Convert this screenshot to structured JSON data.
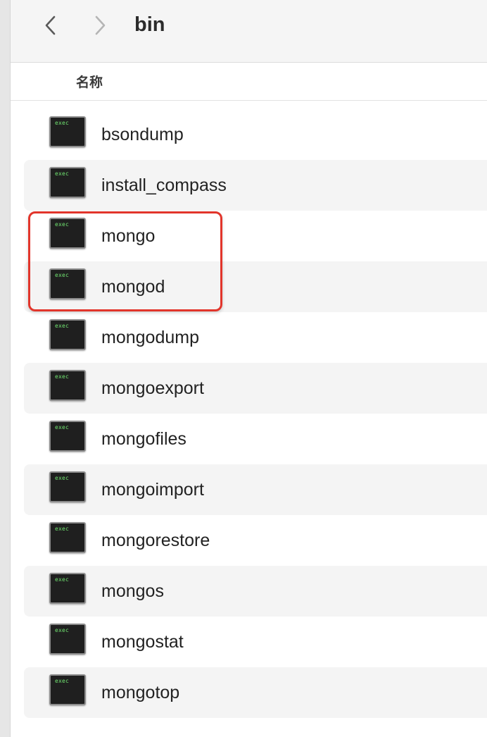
{
  "toolbar": {
    "title": "bin",
    "back_icon": "chevron-left-icon",
    "forward_icon": "chevron-right-icon"
  },
  "column_header": {
    "name_label": "名称"
  },
  "files": [
    {
      "name": "bsondump",
      "icon_label": "exec",
      "icon": "exec-icon"
    },
    {
      "name": "install_compass",
      "icon_label": "exec",
      "icon": "exec-icon"
    },
    {
      "name": "mongo",
      "icon_label": "exec",
      "icon": "exec-icon"
    },
    {
      "name": "mongod",
      "icon_label": "exec",
      "icon": "exec-icon"
    },
    {
      "name": "mongodump",
      "icon_label": "exec",
      "icon": "exec-icon"
    },
    {
      "name": "mongoexport",
      "icon_label": "exec",
      "icon": "exec-icon"
    },
    {
      "name": "mongofiles",
      "icon_label": "exec",
      "icon": "exec-icon"
    },
    {
      "name": "mongoimport",
      "icon_label": "exec",
      "icon": "exec-icon"
    },
    {
      "name": "mongorestore",
      "icon_label": "exec",
      "icon": "exec-icon"
    },
    {
      "name": "mongos",
      "icon_label": "exec",
      "icon": "exec-icon"
    },
    {
      "name": "mongostat",
      "icon_label": "exec",
      "icon": "exec-icon"
    },
    {
      "name": "mongotop",
      "icon_label": "exec",
      "icon": "exec-icon"
    }
  ],
  "colors": {
    "highlight": "#e2352b",
    "exec_text": "#6fe06f",
    "row_alt": "#f4f4f4"
  }
}
